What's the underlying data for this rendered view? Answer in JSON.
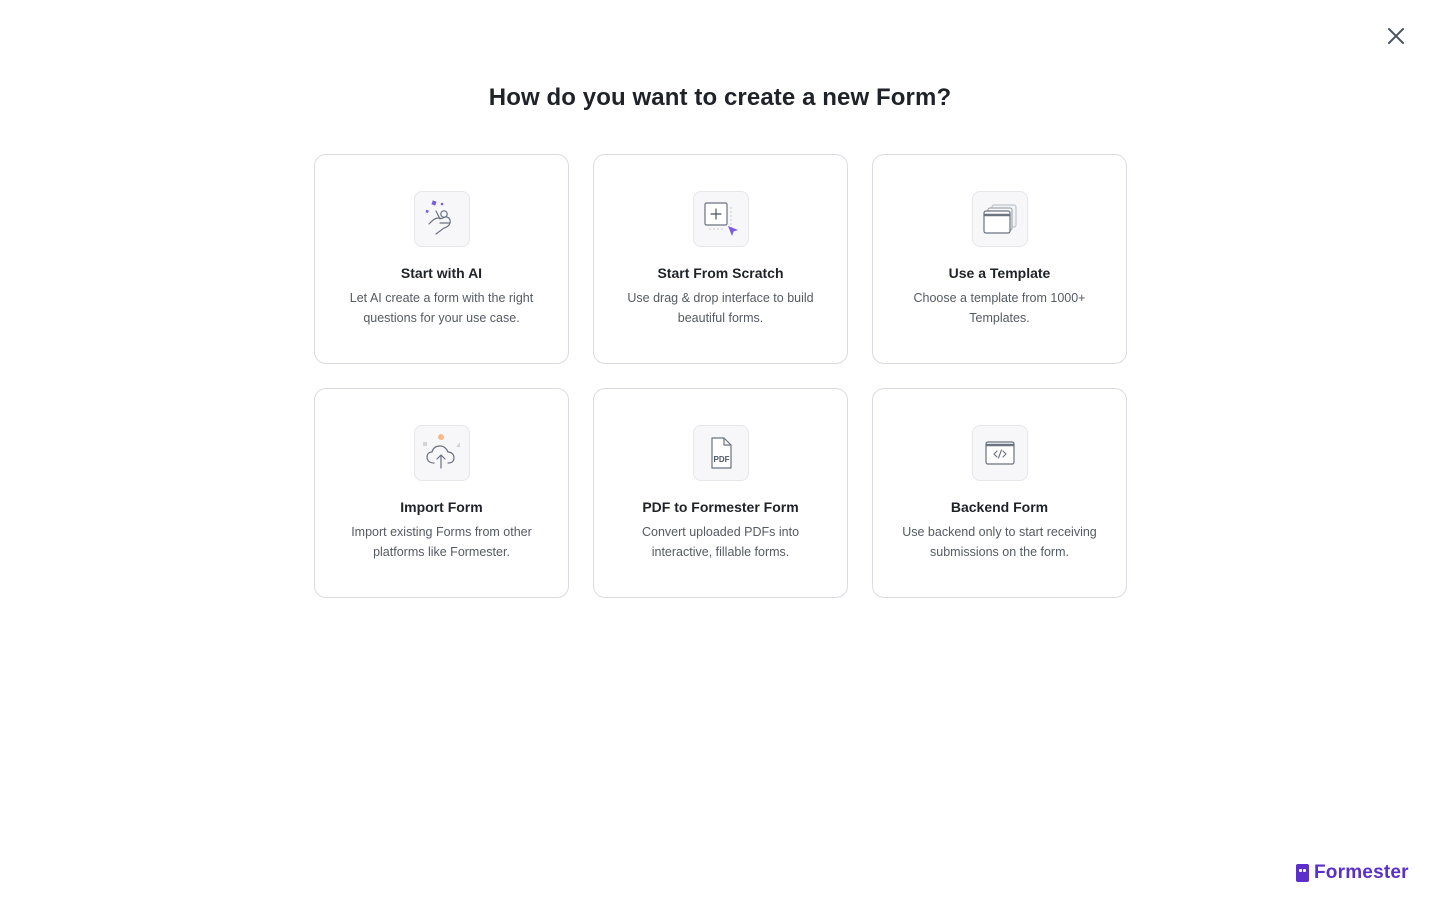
{
  "modal": {
    "title": "How do you want to create a new Form?",
    "close_icon": "close-icon"
  },
  "options": [
    {
      "title": "Start with AI",
      "description": "Let AI create a form with the right questions for your use case.",
      "icon": "ai-magic-hand-icon"
    },
    {
      "title": "Start From Scratch",
      "description": "Use drag & drop interface to build beautiful forms.",
      "icon": "add-cursor-icon"
    },
    {
      "title": "Use a Template",
      "description": "Choose a template from 1000+ Templates.",
      "icon": "template-windows-icon"
    },
    {
      "title": "Import Form",
      "description": "Import existing Forms from other platforms like Formester.",
      "icon": "cloud-upload-icon"
    },
    {
      "title": "PDF to Formester Form",
      "description": "Convert uploaded PDFs into interactive, fillable forms.",
      "icon": "pdf-file-icon"
    },
    {
      "title": "Backend Form",
      "description": "Use backend only to start receiving submissions on the form.",
      "icon": "code-window-icon"
    }
  ],
  "brand": {
    "name": "Formester",
    "color": "#5b2fc9",
    "icon": "formester-logo-icon"
  },
  "colors": {
    "accent": "#7b5ce0",
    "border": "#d9dbe0",
    "text_primary": "#1f2228",
    "text_secondary": "#555a63"
  }
}
